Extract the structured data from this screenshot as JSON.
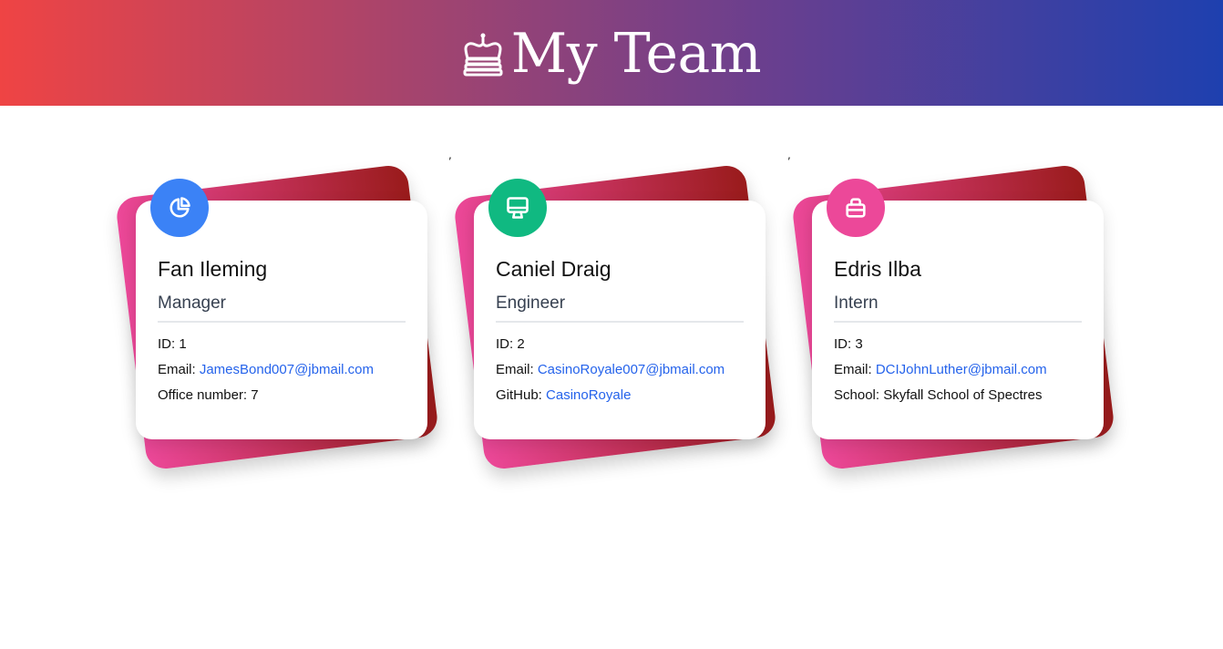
{
  "header": {
    "title": "My Team",
    "icon": "crown-icon"
  },
  "colors": {
    "header_gradient": [
      "#ef4444",
      "#1e40af"
    ],
    "card_back_gradient": [
      "#ec4899",
      "#991b1b"
    ],
    "manager_badge": "#3b82f6",
    "engineer_badge": "#10b981",
    "intern_badge": "#ec4899",
    "link": "#2563eb"
  },
  "separators": [
    ",",
    ","
  ],
  "team": [
    {
      "name": "Fan Ileming",
      "role": "Manager",
      "icon": "pie-chart-icon",
      "id_label": "ID: ",
      "id": "1",
      "email_label": "Email: ",
      "email": "JamesBond007@jbmail.com",
      "extra_label": "Office number: ",
      "extra_value": "7"
    },
    {
      "name": "Caniel Draig",
      "role": "Engineer",
      "icon": "monitor-icon",
      "id_label": "ID: ",
      "id": "2",
      "email_label": "Email: ",
      "email": "CasinoRoyale007@jbmail.com",
      "extra_label": "GitHub: ",
      "extra_value": "CasinoRoyale"
    },
    {
      "name": "Edris Ilba",
      "role": "Intern",
      "icon": "backpack-icon",
      "id_label": "ID: ",
      "id": "3",
      "email_label": "Email: ",
      "email": "DCIJohnLuther@jbmail.com",
      "extra_label": "School: ",
      "extra_value": "Skyfall School of Spectres"
    }
  ]
}
